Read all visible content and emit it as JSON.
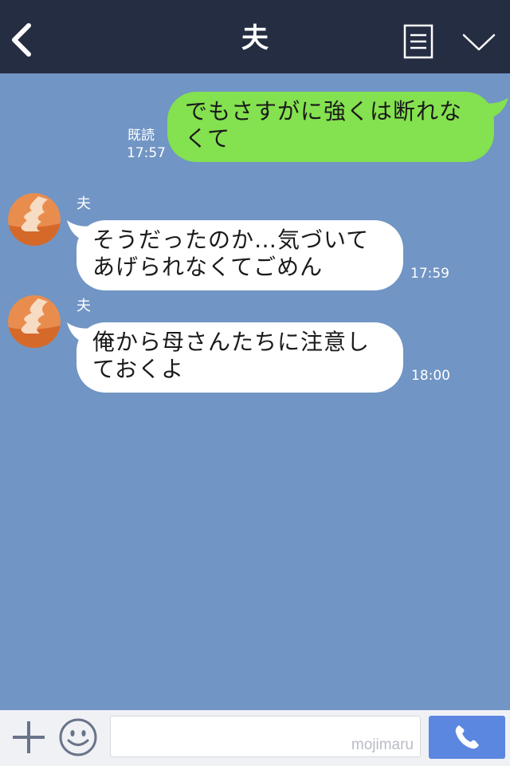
{
  "header": {
    "title": "夫",
    "back_icon": "chevron-left-icon",
    "menu_icon": "note-menu-icon",
    "collapse_icon": "chevron-down-icon"
  },
  "messages": [
    {
      "direction": "sent",
      "text_lines": [
        "でもさすがに強くは断れな",
        "くて"
      ],
      "read_label": "既読",
      "time": "17:57"
    },
    {
      "direction": "received",
      "sender": "夫",
      "text_lines": [
        "そうだったのか…気づいて",
        "あげられなくてごめん"
      ],
      "time": "17:59"
    },
    {
      "direction": "received",
      "sender": "夫",
      "text_lines": [
        "俺から母さんたちに注意し",
        "ておくよ"
      ],
      "time": "18:00"
    }
  ],
  "input_bar": {
    "plus_icon": "plus-icon",
    "emoji_icon": "smiley-icon",
    "watermark": "mojimaru",
    "call_icon": "phone-icon"
  },
  "colors": {
    "header_bg": "#252d42",
    "chat_bg": "#7195c4",
    "sent_bubble": "#84e14f",
    "received_bubble": "#ffffff",
    "call_button": "#5b87e0"
  }
}
